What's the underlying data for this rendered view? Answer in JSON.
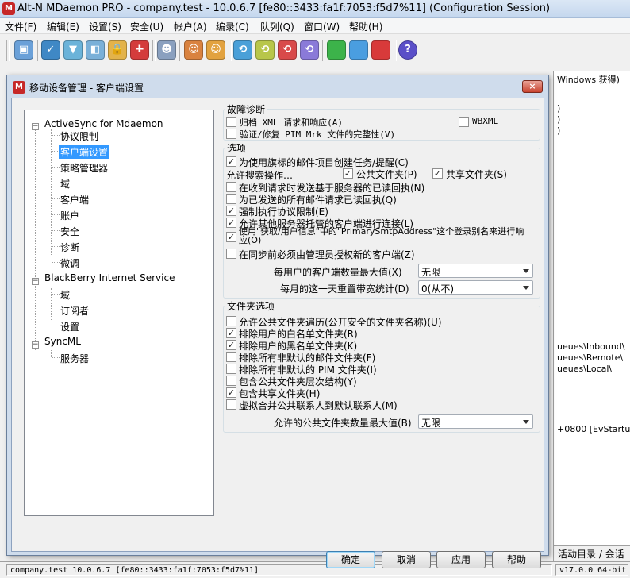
{
  "window": {
    "title": "Alt-N MDaemon PRO - company.test - 10.0.6.7 [fe80::3433:fa1f:7053:f5d7%11] (Configuration Session)"
  },
  "menu": [
    "文件(F)",
    "编辑(E)",
    "设置(S)",
    "安全(U)",
    "帐户(A)",
    "编录(C)",
    "队列(Q)",
    "窗口(W)",
    "帮助(H)"
  ],
  "background_log": {
    "lines": [
      "Windows 获得)",
      ")",
      ")",
      ")",
      "ueues\\Inbound\\",
      "ueues\\Remote\\",
      "ueues\\Local\\",
      "+0800 [EvStartup]"
    ],
    "tabs_label": "活动目录 / 会话"
  },
  "statusbar": {
    "left": "company.test 10.0.6.7 [fe80::3433:fa1f:7053:f5d7%11]",
    "right": "v17.0.0 64-bit"
  },
  "dialog": {
    "title": "移动设备管理 - 客户端设置",
    "close_label": "×",
    "tree": {
      "activesync": {
        "label": "ActiveSync for Mdaemon",
        "children": [
          "协议限制",
          "客户端设置",
          "策略管理器",
          "域",
          "客户端",
          "账户",
          "安全",
          "诊断",
          "微调"
        ]
      },
      "blackberry": {
        "label": "BlackBerry Internet Service",
        "children": [
          "域",
          "订阅者",
          "设置"
        ]
      },
      "syncml": {
        "label": "SyncML",
        "children": [
          "服务器"
        ]
      }
    },
    "diagnostics": {
      "title": "故障诊断",
      "archive_xml": "归档 XML 请求和响应(A)",
      "wbxml": "WBXML",
      "validate_pim": "验证/修复 PIM Mrk 文件的完整性(V)"
    },
    "options": {
      "title": "选项",
      "create_tasks": "为使用旗标的邮件项目创建任务/提醒(C)",
      "search_label": "允许搜索操作…",
      "public_folders": "公共文件夹(P)",
      "shared_folders": "共享文件夹(S)",
      "read_receipt_server": "在收到请求时发送基于服务器的已读回执(N)",
      "read_receipt_sent": "为已发送的所有邮件请求已读回执(Q)",
      "enforce_protocol": "强制执行协议限制(E)",
      "allow_other_hosted": "允许其他服务器托管的客户端进行连接(L)",
      "use_primary_smtp": "使用\"获取/用户信息\"中的\"PrimarySmtpAddress\"这个登录别名来进行响应(O)",
      "admin_authorize": "在同步前必须由管理员授权新的客户端(Z)",
      "max_clients_label": "每用户的客户端数量最大值(X)",
      "max_clients_value": "无限",
      "reset_day_label": "每月的这一天重置带宽统计(D)",
      "reset_day_value": "0(从不)"
    },
    "folder_options": {
      "title": "文件夹选项",
      "allow_traverse": "允许公共文件夹遍历(公开安全的文件夹名称)(U)",
      "exclude_whitelist": "排除用户的白名单文件夹(R)",
      "exclude_blacklist": "排除用户的黑名单文件夹(K)",
      "exclude_nondefault_mail": "排除所有非默认的邮件文件夹(F)",
      "exclude_nondefault_pim": "排除所有非默认的 PIM 文件夹(I)",
      "include_public_hierarchy": "包含公共文件夹层次结构(Y)",
      "include_shared": "包含共享文件夹(H)",
      "virtual_merge": "虚拟合并公共联系人到默认联系人(M)",
      "max_public_label": "允许的公共文件夹数量最大值(B)",
      "max_public_value": "无限"
    },
    "buttons": {
      "ok": "确定",
      "cancel": "取消",
      "apply": "应用",
      "help": "帮助"
    }
  }
}
